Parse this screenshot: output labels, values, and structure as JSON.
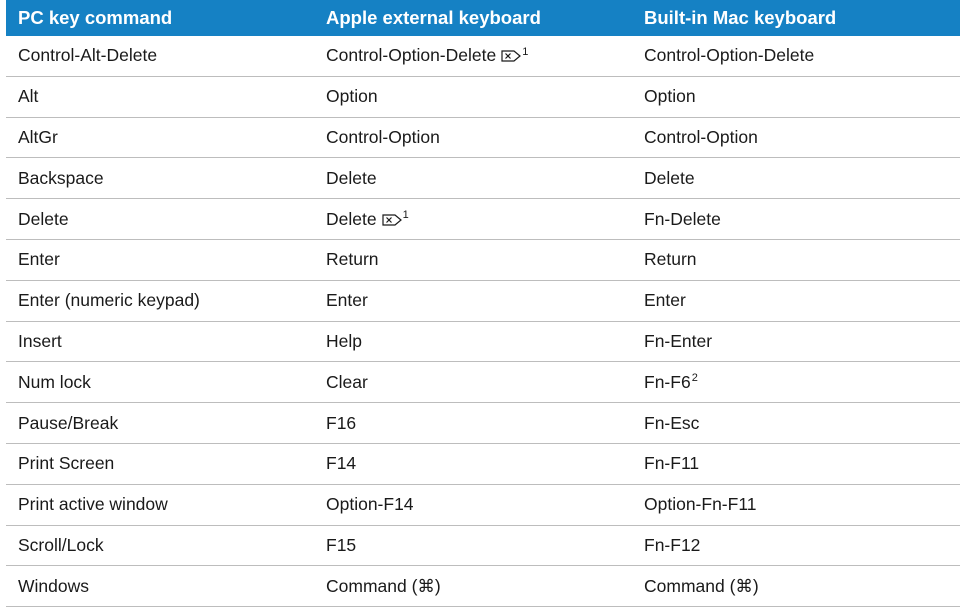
{
  "table": {
    "headers": [
      "PC key command",
      "Apple external keyboard",
      "Built-in Mac keyboard"
    ],
    "rows": [
      {
        "pc": "Control-Alt-Delete",
        "ext": "Control-Option-Delete",
        "ext_icon": "forward-delete-icon",
        "ext_note": "1",
        "mac": "Control-Option-Delete",
        "mac_note": ""
      },
      {
        "pc": "Alt",
        "ext": "Option",
        "ext_icon": "",
        "ext_note": "",
        "mac": "Option",
        "mac_note": ""
      },
      {
        "pc": "AltGr",
        "ext": "Control-Option",
        "ext_icon": "",
        "ext_note": "",
        "mac": "Control-Option",
        "mac_note": ""
      },
      {
        "pc": "Backspace",
        "ext": "Delete",
        "ext_icon": "",
        "ext_note": "",
        "mac": "Delete",
        "mac_note": ""
      },
      {
        "pc": "Delete",
        "ext": "Delete",
        "ext_icon": "forward-delete-icon",
        "ext_note": "1",
        "mac": "Fn-Delete",
        "mac_note": ""
      },
      {
        "pc": "Enter",
        "ext": "Return",
        "ext_icon": "",
        "ext_note": "",
        "mac": "Return",
        "mac_note": ""
      },
      {
        "pc": "Enter (numeric keypad)",
        "ext": "Enter",
        "ext_icon": "",
        "ext_note": "",
        "mac": "Enter",
        "mac_note": ""
      },
      {
        "pc": "Insert",
        "ext": "Help",
        "ext_icon": "",
        "ext_note": "",
        "mac": "Fn-Enter",
        "mac_note": ""
      },
      {
        "pc": "Num lock",
        "ext": "Clear",
        "ext_icon": "",
        "ext_note": "",
        "mac": "Fn-F6",
        "mac_note": "2"
      },
      {
        "pc": "Pause/Break",
        "ext": "F16",
        "ext_icon": "",
        "ext_note": "",
        "mac": "Fn-Esc",
        "mac_note": ""
      },
      {
        "pc": "Print Screen",
        "ext": "F14",
        "ext_icon": "",
        "ext_note": "",
        "mac": "Fn-F11",
        "mac_note": ""
      },
      {
        "pc": "Print active window",
        "ext": "Option-F14",
        "ext_icon": "",
        "ext_note": "",
        "mac": "Option-Fn-F11",
        "mac_note": ""
      },
      {
        "pc": "Scroll/Lock",
        "ext": "F15",
        "ext_icon": "",
        "ext_note": "",
        "mac": "Fn-F12",
        "mac_note": ""
      },
      {
        "pc": "Windows",
        "ext": "Command (⌘)",
        "ext_icon": "",
        "ext_note": "",
        "mac": "Command (⌘)",
        "mac_note": ""
      }
    ]
  },
  "colors": {
    "header_background": "#1581c4",
    "header_text": "#ffffff",
    "row_divider": "#bdbdbd",
    "body_text": "#1a1a1a"
  }
}
